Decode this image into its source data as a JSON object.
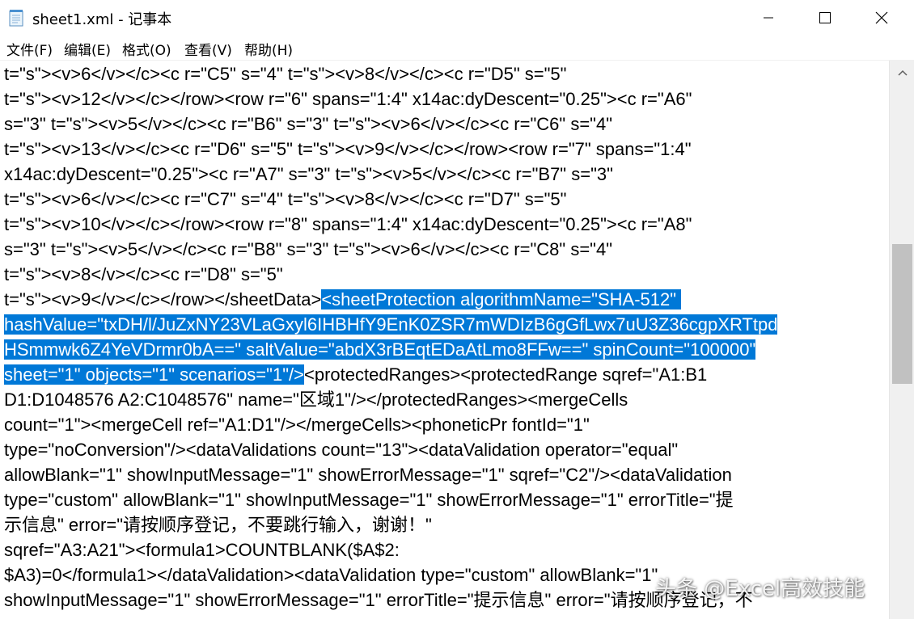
{
  "window": {
    "title": "sheet1.xml - 记事本",
    "icon": "notepad-icon",
    "controls": [
      "minimize-icon",
      "maximize-icon",
      "close-icon"
    ]
  },
  "menu": [
    "文件(F)",
    "编辑(E)",
    "格式(O)",
    "查看(V)",
    "帮助(H)"
  ],
  "editor": {
    "selection_color": "#0078d7",
    "lines": [
      {
        "pre": "t=\"s\"><v>6</v></c><c r=\"C5\" s=\"4\" t=\"s\"><v>8</v></c><c r=\"D5\" s=\"5\"",
        "sel": "",
        "post": ""
      },
      {
        "pre": "t=\"s\"><v>12</v></c></row><row r=\"6\" spans=\"1:4\" x14ac:dyDescent=\"0.25\"><c r=\"A6\"",
        "sel": "",
        "post": ""
      },
      {
        "pre": "s=\"3\" t=\"s\"><v>5</v></c><c r=\"B6\" s=\"3\" t=\"s\"><v>6</v></c><c r=\"C6\" s=\"4\"",
        "sel": "",
        "post": ""
      },
      {
        "pre": "t=\"s\"><v>13</v></c><c r=\"D6\" s=\"5\" t=\"s\"><v>9</v></c></row><row r=\"7\" spans=\"1:4\"",
        "sel": "",
        "post": ""
      },
      {
        "pre": "x14ac:dyDescent=\"0.25\"><c r=\"A7\" s=\"3\" t=\"s\"><v>5</v></c><c r=\"B7\" s=\"3\"",
        "sel": "",
        "post": ""
      },
      {
        "pre": "t=\"s\"><v>6</v></c><c r=\"C7\" s=\"4\" t=\"s\"><v>8</v></c><c r=\"D7\" s=\"5\"",
        "sel": "",
        "post": ""
      },
      {
        "pre": "t=\"s\"><v>10</v></c></row><row r=\"8\" spans=\"1:4\" x14ac:dyDescent=\"0.25\"><c r=\"A8\"",
        "sel": "",
        "post": ""
      },
      {
        "pre": "s=\"3\" t=\"s\"><v>5</v></c><c r=\"B8\" s=\"3\" t=\"s\"><v>6</v></c><c r=\"C8\" s=\"4\"",
        "sel": "",
        "post": ""
      },
      {
        "pre": "t=\"s\"><v>8</v></c><c r=\"D8\" s=\"5\"",
        "sel": "",
        "post": ""
      },
      {
        "pre": "t=\"s\"><v>9</v></c></row></sheetData>",
        "sel": "<sheetProtection algorithmName=\"SHA-512\" ",
        "post": ""
      },
      {
        "pre": "",
        "sel": "hashValue=\"txDH/l/JuZxNY23VLaGxyl6IHBHfY9EnK0ZSR7mWDIzB6gGfLwx7uU3Z36cgpXRTtpd",
        "post": ""
      },
      {
        "pre": "",
        "sel": "HSmmwk6Z4YeVDrmr0bA==\" saltValue=\"abdX3rBEqtEDaAtLmo8FFw==\" spinCount=\"100000\"",
        "post": ""
      },
      {
        "pre": "",
        "sel": "sheet=\"1\" objects=\"1\" scenarios=\"1\"/>",
        "post": "<protectedRanges><protectedRange sqref=\"A1:B1"
      },
      {
        "pre": "D1:D1048576 A2:C1048576\" name=\"区域1\"/></protectedRanges><mergeCells",
        "sel": "",
        "post": ""
      },
      {
        "pre": "count=\"1\"><mergeCell ref=\"A1:D1\"/></mergeCells><phoneticPr fontId=\"1\"",
        "sel": "",
        "post": ""
      },
      {
        "pre": "type=\"noConversion\"/><dataValidations count=\"13\"><dataValidation operator=\"equal\"",
        "sel": "",
        "post": ""
      },
      {
        "pre": "allowBlank=\"1\" showInputMessage=\"1\" showErrorMessage=\"1\" sqref=\"C2\"/><dataValidation",
        "sel": "",
        "post": ""
      },
      {
        "pre": "type=\"custom\" allowBlank=\"1\" showInputMessage=\"1\" showErrorMessage=\"1\" errorTitle=\"提",
        "sel": "",
        "post": ""
      },
      {
        "pre": "示信息\" error=\"请按顺序登记，不要跳行输入，谢谢！\"",
        "sel": "",
        "post": ""
      },
      {
        "pre": "sqref=\"A3:A21\"><formula1>COUNTBLANK($A$2:",
        "sel": "",
        "post": ""
      },
      {
        "pre": "$A3)=0</formula1></dataValidation><dataValidation type=\"custom\" allowBlank=\"1\"",
        "sel": "",
        "post": ""
      },
      {
        "pre": "showInputMessage=\"1\" showErrorMessage=\"1\" errorTitle=\"提示信息\" error=\"请按顺序登记，不",
        "sel": "",
        "post": ""
      }
    ]
  },
  "scrollbar": {
    "position": 0.33
  },
  "watermark": "头条 @Excel高效技能"
}
